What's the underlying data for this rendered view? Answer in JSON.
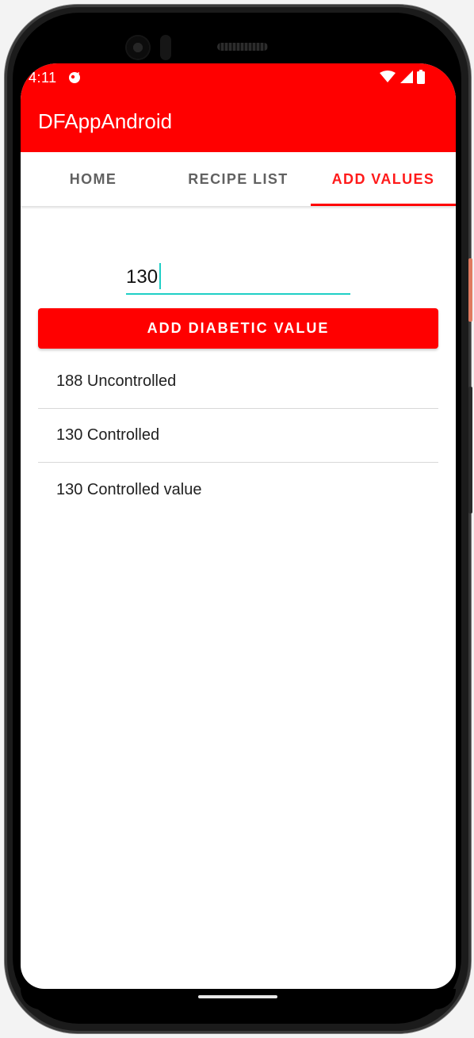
{
  "status_bar": {
    "time": "4:11",
    "left_icon": "notification-icon",
    "right_icons": [
      "wifi-icon",
      "signal-icon",
      "battery-icon"
    ]
  },
  "app_bar": {
    "title": "DFAppAndroid",
    "color": "#ff0000"
  },
  "tabs": [
    {
      "label": "HOME",
      "active": false
    },
    {
      "label": "RECIPE LIST",
      "active": false
    },
    {
      "label": "ADD VALUES",
      "active": true
    }
  ],
  "form": {
    "value": "130",
    "button_label": "ADD DIABETIC VALUE",
    "accent_color": "#1fcfc6"
  },
  "values_list": [
    "188 Uncontrolled",
    "130 Controlled",
    "130 Controlled value"
  ]
}
